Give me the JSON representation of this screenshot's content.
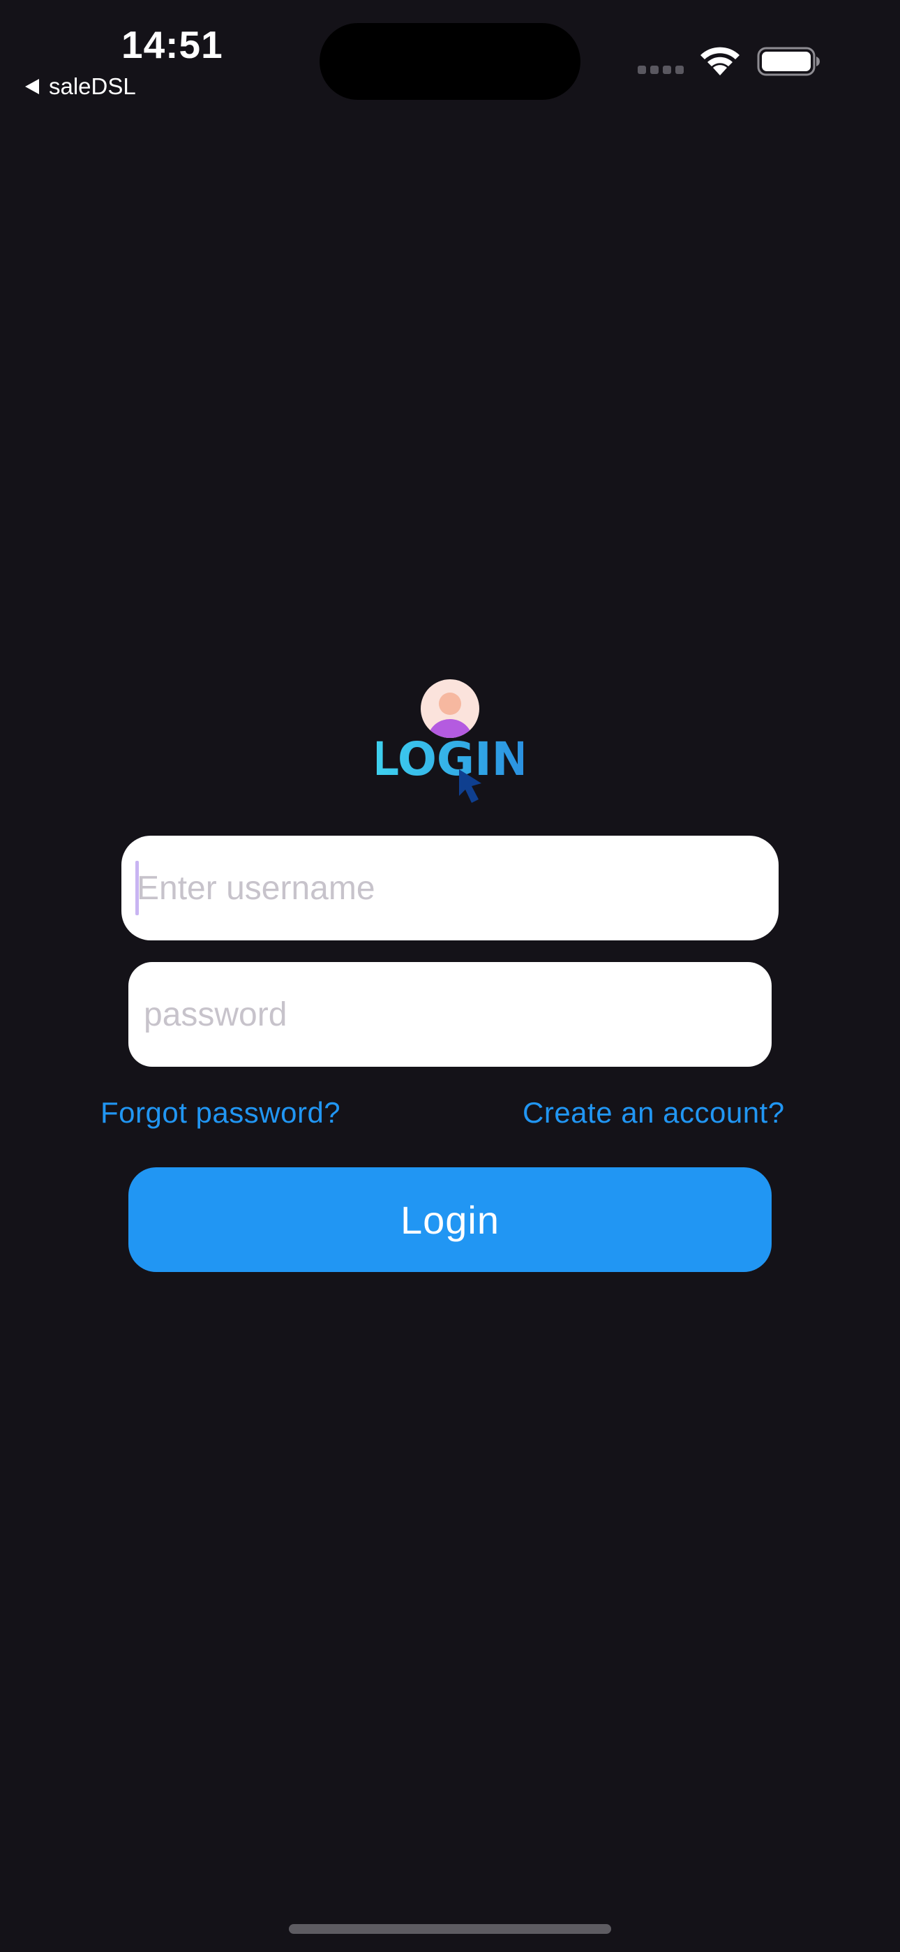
{
  "status_bar": {
    "time": "14:51",
    "back_app": "saleDSL"
  },
  "logo": {
    "text": "LOGIN"
  },
  "form": {
    "username_placeholder": "Enter username",
    "username_value": "",
    "password_placeholder": "password",
    "password_value": "",
    "forgot_password_label": "Forgot password?",
    "create_account_label": "Create an account?",
    "login_button_label": "Login"
  },
  "colors": {
    "background": "#141218",
    "accent": "#2196f3",
    "input_background": "#ffffff",
    "placeholder": "#c7c3cb"
  }
}
